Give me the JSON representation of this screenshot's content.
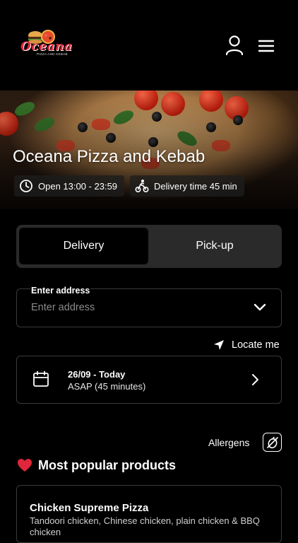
{
  "header": {
    "logo_name": "Oceana",
    "logo_tagline": "PIZZA AND KEBAB",
    "icons": [
      "user-icon",
      "hamburger-menu-icon"
    ]
  },
  "hero": {
    "title": "Oceana Pizza and Kebab",
    "open_hours": "Open 13:00 - 23:59",
    "delivery_time": "Delivery time 45 min",
    "icons": [
      "clock-icon",
      "courier-bike-icon"
    ]
  },
  "order_mode": {
    "options": [
      "Delivery",
      "Pick-up"
    ],
    "selected": "Delivery"
  },
  "address": {
    "label": "Enter address",
    "placeholder": "Enter address",
    "value": "",
    "locate_label": "Locate me"
  },
  "schedule": {
    "date": "26/09 - Today",
    "time": "ASAP (45 minutes)"
  },
  "allergens": {
    "label": "Allergens"
  },
  "popular": {
    "title": "Most popular products",
    "products": [
      {
        "name": "Chicken Supreme Pizza",
        "description": "Tandoori chicken, Chinese chicken, plain chicken & BBQ chicken"
      }
    ]
  },
  "colors": {
    "background": "#000000",
    "toggle_track": "#2a2a2a",
    "border": "#3a3a3a",
    "logo_red": "#e0263a",
    "heart": "#e0263a"
  }
}
